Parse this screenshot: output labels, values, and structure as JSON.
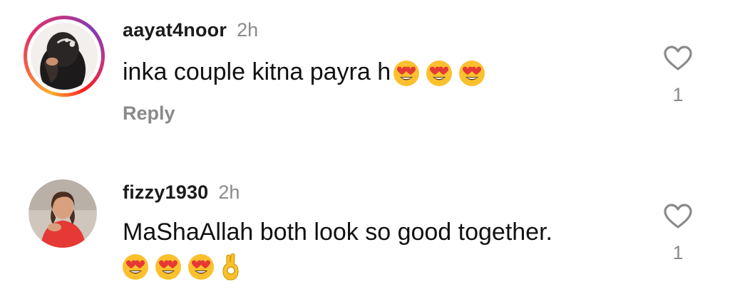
{
  "comments": [
    {
      "username": "aayat4noor",
      "time": "2h",
      "text": "inka couple kitna payra h",
      "emojis": [
        "heart-eyes-emoji",
        "heart-eyes-emoji",
        "heart-eyes-emoji"
      ],
      "reply_label": "Reply",
      "like_count": "1",
      "has_story_ring": true
    },
    {
      "username": "fizzy1930",
      "time": "2h",
      "text": "MaShaAllah both look so good together.",
      "emojis": [
        "heart-eyes-emoji",
        "heart-eyes-emoji",
        "heart-eyes-emoji",
        "ok-hand-emoji"
      ],
      "like_count": "1",
      "has_story_ring": false
    }
  ],
  "icons": {
    "like": "heart-outline-icon"
  },
  "colors": {
    "text": "#111111",
    "muted": "#8a8a8a",
    "background": "#ffffff"
  }
}
